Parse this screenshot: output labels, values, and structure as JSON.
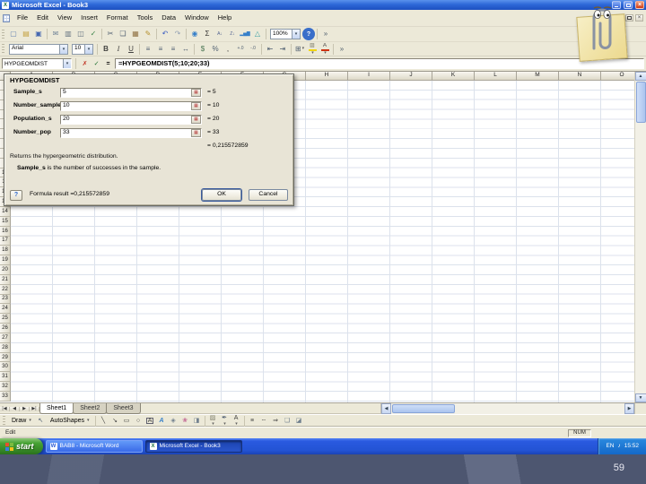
{
  "window": {
    "title": "Microsoft Excel - Book3"
  },
  "menu_bar": {
    "items": [
      "File",
      "Edit",
      "View",
      "Insert",
      "Format",
      "Tools",
      "Data",
      "Window",
      "Help"
    ]
  },
  "standard_toolbar": {
    "icons": [
      {
        "grip": true
      },
      {
        "name": "new-workbook-icon",
        "glyph": "▢",
        "color": "#5a7ab0"
      },
      {
        "name": "open-icon",
        "glyph": "▤",
        "color": "#c09a30"
      },
      {
        "name": "save-icon",
        "glyph": "▣",
        "color": "#3a5fae"
      },
      {
        "sep": true
      },
      {
        "name": "email-icon",
        "glyph": "✉",
        "color": "#667b92"
      },
      {
        "name": "print-icon",
        "glyph": "▥",
        "color": "#5a6a7a"
      },
      {
        "name": "print-preview-icon",
        "glyph": "◫",
        "color": "#5a6a7a"
      },
      {
        "name": "spelling-icon",
        "glyph": "✓",
        "color": "#2a7a3a"
      },
      {
        "sep": true
      },
      {
        "name": "cut-icon",
        "glyph": "✂",
        "color": "#44556a"
      },
      {
        "name": "copy-icon",
        "glyph": "❏",
        "color": "#44556a"
      },
      {
        "name": "paste-icon",
        "glyph": "▦",
        "color": "#8a6a3a"
      },
      {
        "name": "format-painter-icon",
        "glyph": "✎",
        "color": "#b08a20"
      },
      {
        "sep": true
      },
      {
        "name": "undo-icon",
        "glyph": "↶",
        "color": "#2a50c0"
      },
      {
        "name": "redo-icon",
        "glyph": "↷",
        "color": "#8a9ab0"
      },
      {
        "sep": true
      },
      {
        "name": "hyperlink-icon",
        "glyph": "◉",
        "color": "#2878c8"
      },
      {
        "name": "autosum-icon",
        "glyph": "Σ",
        "color": "#222222"
      },
      {
        "name": "sort-ascending-icon",
        "glyph": "A↓",
        "color": "#44568a"
      },
      {
        "name": "sort-descending-icon",
        "glyph": "Z↓",
        "color": "#44568a"
      },
      {
        "name": "chart-wizard-icon",
        "glyph": "▂▅▇",
        "color": "#2878c8"
      },
      {
        "name": "drawing-icon",
        "glyph": "△",
        "color": "#2898a0"
      },
      {
        "sep": true
      }
    ],
    "zoom_value": "100%",
    "tail_icons": [
      {
        "name": "help-icon",
        "glyph": "?",
        "color": "#ffffff",
        "bg": "#2a64c8"
      },
      {
        "sep": true
      },
      {
        "name": "toolbar-options-icon",
        "glyph": "»",
        "color": "#445566"
      }
    ]
  },
  "formatting_toolbar": {
    "font_name": "Arial",
    "font_size": "10",
    "icons": [
      {
        "sep": true
      },
      {
        "name": "bold-icon",
        "glyph": "B",
        "color": "#333333"
      },
      {
        "name": "italic-icon",
        "glyph": "I",
        "color": "#333333"
      },
      {
        "name": "underline-icon",
        "glyph": "U",
        "color": "#333333"
      },
      {
        "sep": true
      },
      {
        "name": "align-left-icon",
        "glyph": "≡",
        "color": "#44556a"
      },
      {
        "name": "align-center-icon",
        "glyph": "≡",
        "color": "#44556a"
      },
      {
        "name": "align-right-icon",
        "glyph": "≡",
        "color": "#44556a"
      },
      {
        "name": "merge-center-icon",
        "glyph": "↔",
        "color": "#44556a"
      },
      {
        "sep": true
      },
      {
        "name": "currency-icon",
        "glyph": "$",
        "color": "#3a6a46"
      },
      {
        "name": "percent-icon",
        "glyph": "%",
        "color": "#44556a"
      },
      {
        "name": "comma-icon",
        "glyph": ",",
        "color": "#222222"
      },
      {
        "name": "increase-decimal-icon",
        "glyph": "+.0",
        "color": "#44556a"
      },
      {
        "name": "decrease-decimal-icon",
        "glyph": "-.0",
        "color": "#44556a"
      },
      {
        "sep": true
      },
      {
        "name": "decrease-indent-icon",
        "glyph": "⇤",
        "color": "#44556a"
      },
      {
        "name": "increase-indent-icon",
        "glyph": "⇥",
        "color": "#44556a"
      },
      {
        "sep": true
      },
      {
        "name": "borders-icon",
        "glyph": "⊞",
        "color": "#44556a",
        "dd": true
      },
      {
        "name": "fill-color-icon",
        "glyph": "▨",
        "color": "#777766",
        "bar": "#f2d400",
        "dd": true
      },
      {
        "name": "font-color-icon",
        "glyph": "A",
        "color": "#333333",
        "bar": "#cc2200",
        "dd": true
      },
      {
        "sep": true
      },
      {
        "name": "toolbar-options-icon",
        "glyph": "»",
        "color": "#445566"
      }
    ]
  },
  "formula_bar": {
    "name_box": "HYPGEOMDIST",
    "formula": "=HYPGEOMDIST(5;10;20;33)"
  },
  "dialog": {
    "title": "HYPGEOMDIST",
    "fields": [
      {
        "label": "Sample_s",
        "value": "5",
        "result": "= 5"
      },
      {
        "label": "Number_sample",
        "value": "10",
        "result": "= 10"
      },
      {
        "label": "Population_s",
        "value": "20",
        "result": "= 20"
      },
      {
        "label": "Number_pop",
        "value": "33",
        "result": "= 33"
      }
    ],
    "result_line": "= 0,215572859",
    "description": "Returns the hypergeometric distribution.",
    "arg_help_bold": "Sample_s",
    "arg_help_text": " is the number of successes in the sample.",
    "formula_result_label": "Formula result =",
    "formula_result_value": "0,215572859",
    "ok_label": "OK",
    "cancel_label": "Cancel"
  },
  "grid": {
    "columns": [
      "A",
      "B",
      "C",
      "D",
      "E",
      "F",
      "G",
      "H",
      "I",
      "J",
      "K",
      "L",
      "M",
      "N",
      "O"
    ],
    "row_count": 33
  },
  "sheet_tabs": {
    "nav": [
      {
        "name": "first-sheet-button",
        "glyph": "|◀"
      },
      {
        "name": "prev-sheet-button",
        "glyph": "◀"
      },
      {
        "name": "next-sheet-button",
        "glyph": "▶"
      },
      {
        "name": "last-sheet-button",
        "glyph": "▶|"
      }
    ],
    "tabs": [
      "Sheet1",
      "Sheet2",
      "Sheet3"
    ],
    "active_index": 0
  },
  "drawing_toolbar": {
    "items": [
      {
        "grip": true
      },
      {
        "name": "draw-menu",
        "label": "Draw"
      },
      {
        "name": "select-objects-icon",
        "glyph": "↖",
        "color": "#44556a"
      },
      {
        "name": "autoshapes-menu",
        "label": "AutoShapes"
      },
      {
        "sep": true
      },
      {
        "name": "line-icon",
        "glyph": "╲",
        "color": "#333333"
      },
      {
        "name": "arrow-icon",
        "glyph": "↘",
        "color": "#333333"
      },
      {
        "name": "rectangle-icon",
        "glyph": "▭",
        "color": "#333333"
      },
      {
        "name": "oval-icon",
        "glyph": "○",
        "color": "#333333"
      },
      {
        "name": "text-box-icon",
        "glyph": "A",
        "color": "#333333"
      },
      {
        "name": "wordart-icon",
        "glyph": "A",
        "color": "#2878c8"
      },
      {
        "name": "diagram-icon",
        "glyph": "◈",
        "color": "#667788"
      },
      {
        "name": "clip-art-icon",
        "glyph": "❀",
        "color": "#c06090"
      },
      {
        "name": "insert-picture-icon",
        "glyph": "◨",
        "color": "#667788"
      },
      {
        "sep": true
      },
      {
        "name": "fill-color-icon",
        "glyph": "▨",
        "color": "#777766",
        "bar": "#f2d400",
        "dd": true
      },
      {
        "name": "line-color-icon",
        "glyph": "✒",
        "color": "#44556a",
        "bar": "#3355cc",
        "dd": true
      },
      {
        "name": "font-color-icon",
        "glyph": "A",
        "color": "#333333",
        "bar": "#cc2200",
        "dd": true
      },
      {
        "sep": true
      },
      {
        "name": "line-style-icon",
        "glyph": "≡",
        "color": "#333333"
      },
      {
        "name": "dash-style-icon",
        "glyph": "┄",
        "color": "#333333"
      },
      {
        "name": "arrow-style-icon",
        "glyph": "⇒",
        "color": "#333333"
      },
      {
        "name": "shadow-style-icon",
        "glyph": "❏",
        "color": "#667788"
      },
      {
        "name": "3d-style-icon",
        "glyph": "◪",
        "color": "#667788"
      }
    ]
  },
  "status_bar": {
    "mode": "Edit",
    "num_indicator": "NUM"
  },
  "taskbar": {
    "start_label": "start",
    "tasks": [
      {
        "label": "BAB8 - Microsoft Word",
        "icon_letter": "W",
        "icon_color": "#2a5bd7"
      },
      {
        "label": "Microsoft Excel - Book3",
        "icon_letter": "X",
        "icon_color": "#1e7145",
        "active": true
      }
    ],
    "tray": {
      "language": "EN",
      "time": "15:52"
    }
  },
  "desktop": {
    "page_number": "59"
  },
  "glyphs": {
    "excel_icon": "X",
    "minimize": "–",
    "close": "×",
    "dropdown": "▾",
    "cancel": "✗",
    "enter": "✓",
    "edit_formula": "=",
    "scroll_up": "▲",
    "scroll_down": "▼",
    "scroll_left": "◀",
    "scroll_right": "▶",
    "collapse_dialog": "▦",
    "dialog_help": "?",
    "volume": "♪"
  }
}
